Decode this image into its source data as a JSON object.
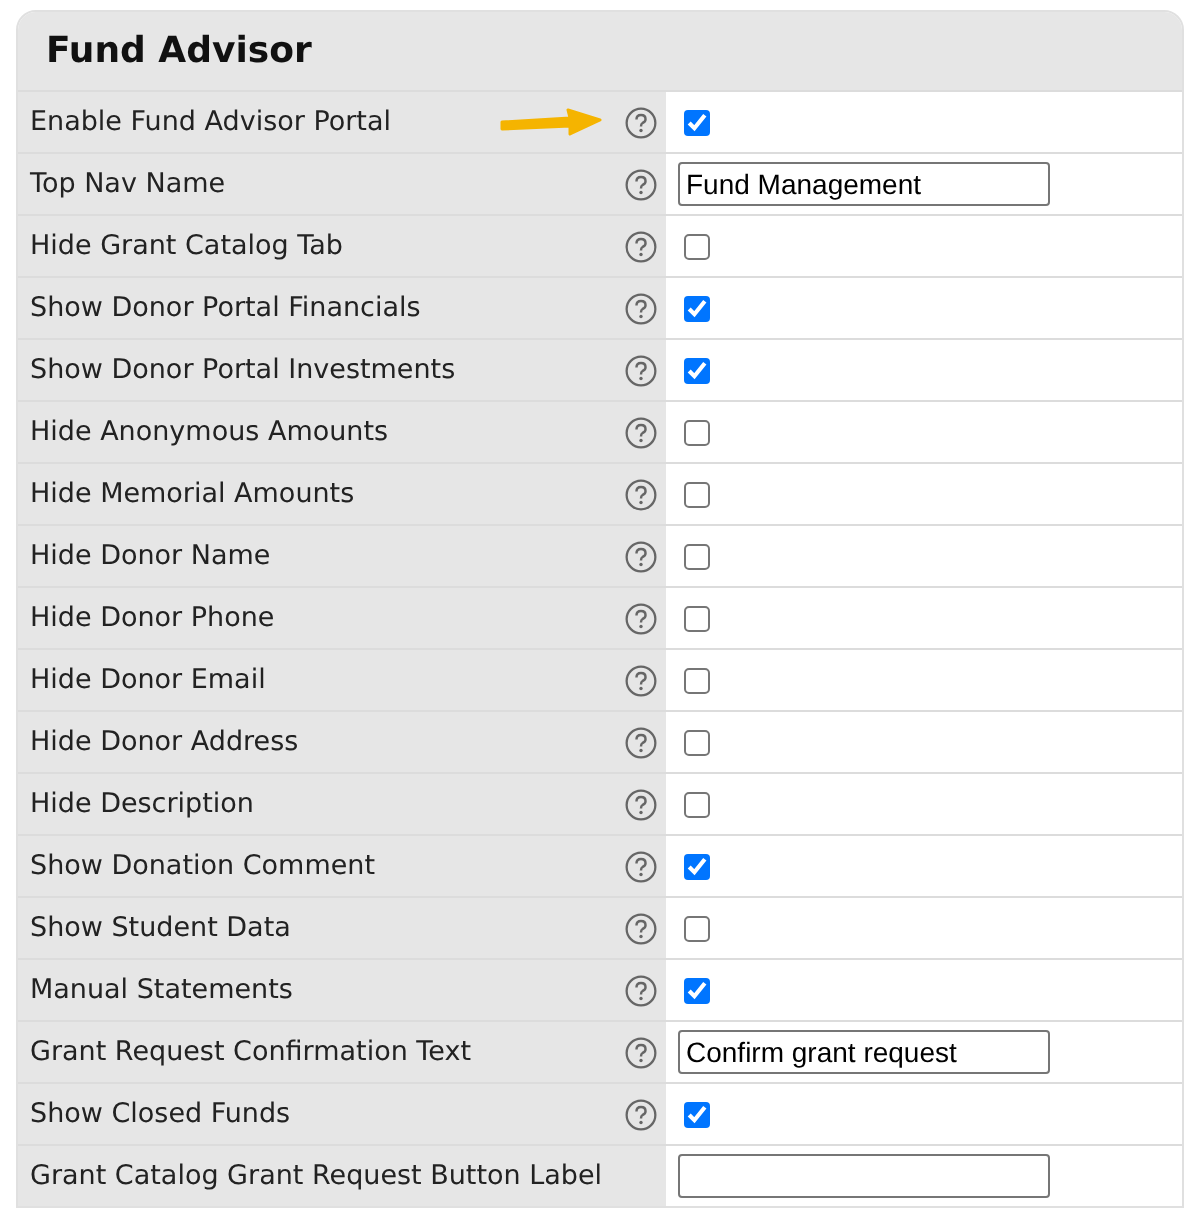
{
  "panel": {
    "title": "Fund Advisor"
  },
  "rows": [
    {
      "label": "Enable Fund Advisor Portal",
      "help": true,
      "kind": "checkbox",
      "checked": true,
      "arrow": true
    },
    {
      "label": "Top Nav Name",
      "help": true,
      "kind": "text",
      "value": "Fund Management",
      "arrow": false
    },
    {
      "label": "Hide Grant Catalog Tab",
      "help": true,
      "kind": "checkbox",
      "checked": false,
      "arrow": false
    },
    {
      "label": "Show Donor Portal Financials",
      "help": true,
      "kind": "checkbox",
      "checked": true,
      "arrow": false
    },
    {
      "label": "Show Donor Portal Investments",
      "help": true,
      "kind": "checkbox",
      "checked": true,
      "arrow": false
    },
    {
      "label": "Hide Anonymous Amounts",
      "help": true,
      "kind": "checkbox",
      "checked": false,
      "arrow": false
    },
    {
      "label": "Hide Memorial Amounts",
      "help": true,
      "kind": "checkbox",
      "checked": false,
      "arrow": false
    },
    {
      "label": "Hide Donor Name",
      "help": true,
      "kind": "checkbox",
      "checked": false,
      "arrow": false
    },
    {
      "label": "Hide Donor Phone",
      "help": true,
      "kind": "checkbox",
      "checked": false,
      "arrow": false
    },
    {
      "label": "Hide Donor Email",
      "help": true,
      "kind": "checkbox",
      "checked": false,
      "arrow": false
    },
    {
      "label": "Hide Donor Address",
      "help": true,
      "kind": "checkbox",
      "checked": false,
      "arrow": false
    },
    {
      "label": "Hide Description",
      "help": true,
      "kind": "checkbox",
      "checked": false,
      "arrow": false
    },
    {
      "label": "Show Donation Comment",
      "help": true,
      "kind": "checkbox",
      "checked": true,
      "arrow": false
    },
    {
      "label": "Show Student Data",
      "help": true,
      "kind": "checkbox",
      "checked": false,
      "arrow": false
    },
    {
      "label": "Manual Statements",
      "help": true,
      "kind": "checkbox",
      "checked": true,
      "arrow": false
    },
    {
      "label": "Grant Request Confirmation Text",
      "help": true,
      "kind": "text",
      "value": "Confirm grant request",
      "arrow": false
    },
    {
      "label": "Show Closed Funds",
      "help": true,
      "kind": "checkbox",
      "checked": true,
      "arrow": false
    },
    {
      "label": "Grant Catalog Grant Request Button Label",
      "help": false,
      "kind": "text",
      "value": "",
      "arrow": false
    }
  ]
}
